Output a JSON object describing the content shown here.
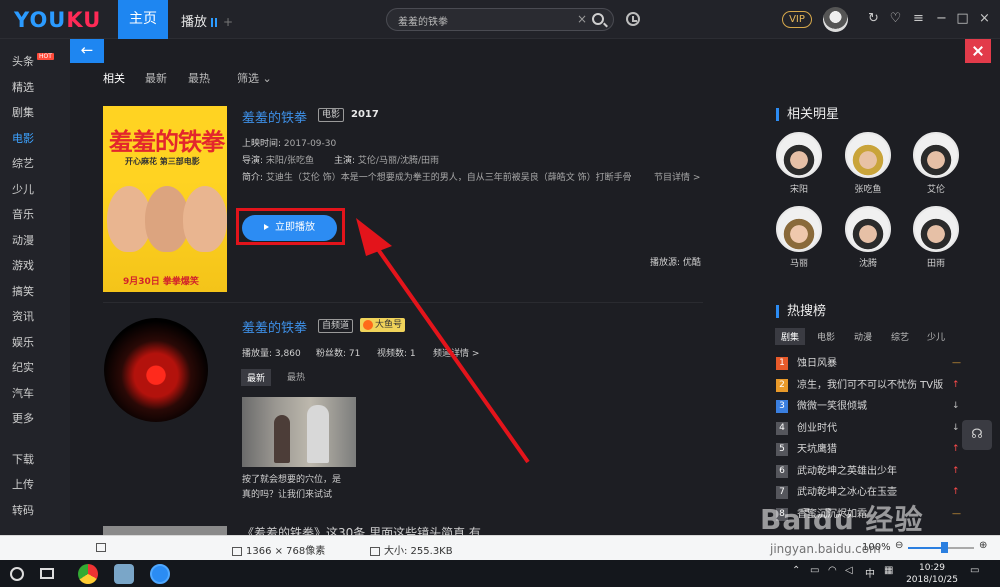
{
  "topbar": {
    "logo_main": "YOU",
    "logo_accent": "KU",
    "nav_home": "主页",
    "nav_play": "播放",
    "nav_plus": "+",
    "search_value": "羞羞的铁拳",
    "clear_glyph": "×",
    "vip": "VIP",
    "icons": [
      "clock-icon",
      "refresh-icon",
      "skin-icon",
      "minimize-icon",
      "maximize-icon",
      "close-icon"
    ]
  },
  "sidebar": {
    "hot_badge": "HOT",
    "items": [
      "头条",
      "精选",
      "剧集",
      "电影",
      "综艺",
      "少儿",
      "音乐",
      "动漫",
      "游戏",
      "搞笑",
      "资讯",
      "娱乐",
      "纪实",
      "汽车",
      "更多"
    ],
    "active_index": 3,
    "bottom": [
      "下载",
      "上传",
      "转码"
    ]
  },
  "content": {
    "back": "←",
    "tabs": [
      "相关",
      "最新",
      "最热",
      "筛选"
    ],
    "filter_caret": "⌄",
    "movie": {
      "poster_title": "羞羞的铁拳",
      "poster_sub": "开心麻花 第三部电影",
      "poster_date": "9月30日 拳拳爆笑",
      "title": "羞羞的铁拳",
      "tag": "电影",
      "year": "2017",
      "release_label": "上映时间:",
      "release_value": "2017-09-30",
      "director_label": "导演:",
      "director_value": "宋阳/张吃鱼",
      "cast_label": "主演:",
      "cast_value": "艾伦/马丽/沈腾/田雨",
      "intro_label": "简介:",
      "intro_value": "艾迪生（艾伦 饰）本是一个想要成为拳王的男人，自从三年前被吴良（薛皓文 饰）打断手骨",
      "detail_link": "节目详情 >",
      "play_button": "立即播放",
      "source": "播放源: 优酷"
    },
    "channel": {
      "title": "羞羞的铁拳",
      "tag": "自频道",
      "tag2": "大鱼号",
      "plays_label": "播放量:",
      "plays_value": "3,860",
      "fans_label": "粉丝数:",
      "fans_value": "71",
      "videos_label": "视频数:",
      "videos_value": "1",
      "detail_link": "频道详情 >",
      "subtabs": [
        "最新",
        "最热"
      ],
      "video_caption_1": "按了就会想要的穴位，是",
      "video_caption_2": "真的吗？让我们来试试"
    },
    "next_title": "《羞羞的铁拳》这30条 里面这些镜头简直 有"
  },
  "right": {
    "stars_heading": "相关明星",
    "stars": [
      "宋阳",
      "张吃鱼",
      "艾伦",
      "马丽",
      "沈腾",
      "田雨"
    ],
    "hot_heading": "热搜榜",
    "hot_tabs": [
      "剧集",
      "电影",
      "动漫",
      "综艺",
      "少儿"
    ],
    "hot_list": [
      {
        "rank": "1",
        "title": "蚀日风暴",
        "trend": "flat"
      },
      {
        "rank": "2",
        "title": "凉生，我们可不可以不忧伤 TV版",
        "trend": "up"
      },
      {
        "rank": "3",
        "title": "微微一笑很倾城",
        "trend": "down"
      },
      {
        "rank": "4",
        "title": "创业时代",
        "trend": "down"
      },
      {
        "rank": "5",
        "title": "天坑鹰猎",
        "trend": "up"
      },
      {
        "rank": "6",
        "title": "武动乾坤之英雄出少年",
        "trend": "up"
      },
      {
        "rank": "7",
        "title": "武动乾坤之冰心在玉壶",
        "trend": "up"
      },
      {
        "rank": "8",
        "title": "香蜜沉沉烬如霜",
        "trend": "flat"
      }
    ]
  },
  "viewer": {
    "dims": "1366 × 768像素",
    "size": "大小: 255.3KB",
    "zoom": "100%",
    "zoom_fraction": 0.55
  },
  "taskbar": {
    "time": "10:29",
    "date": "2018/10/25",
    "ime": "中"
  },
  "watermark": {
    "main": "Baidu 经验",
    "sub": "jingyan.baidu.com"
  }
}
